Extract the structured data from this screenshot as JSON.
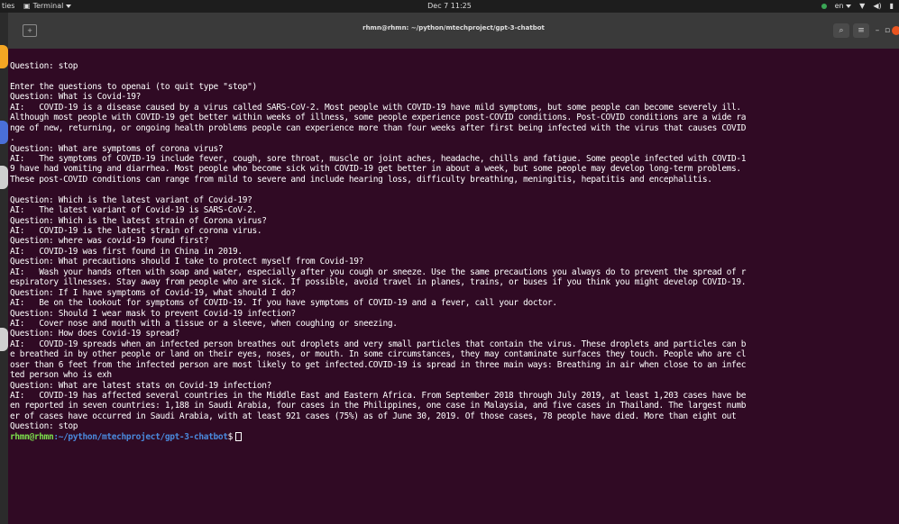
{
  "topbar": {
    "activities": "ties",
    "app_menu": "Terminal",
    "clock": "Dec 7  11:25",
    "keyboard": "en"
  },
  "window": {
    "title": "rhmn@rhmn: ~/python/mtechproject/gpt-3-chatbot"
  },
  "terminal": {
    "lines": [
      "Question: stop",
      "",
      "Enter the questions to openai (to quit type \"stop\")",
      "Question: What is Covid-19?",
      "AI:   COVID-19 is a disease caused by a virus called SARS-CoV-2. Most people with COVID-19 have mild symptoms, but some people can become severely ill.",
      "Although most people with COVID-19 get better within weeks of illness, some people experience post-COVID conditions. Post-COVID conditions are a wide ra",
      "nge of new, returning, or ongoing health problems people can experience more than four weeks after first being infected with the virus that causes COVID",
      ".",
      "Question: What are symptoms of corona virus?",
      "AI:   The symptoms of COVID-19 include fever, cough, sore throat, muscle or joint aches, headache, chills and fatigue. Some people infected with COVID-1",
      "9 have had vomiting and diarrhea. Most people who become sick with COVID-19 get better in about a week, but some people may develop long-term problems.",
      "These post-COVID conditions can range from mild to severe and include hearing loss, difficulty breathing, meningitis, hepatitis and encephalitis.",
      "",
      "Question: Which is the latest variant of Covid-19?",
      "AI:   The latest variant of Covid-19 is SARS-CoV-2.",
      "Question: Which is the latest strain of Corona virus?",
      "AI:   COVID-19 is the latest strain of corona virus.",
      "Question: where was covid-19 found first?",
      "AI:   COVID-19 was first found in China in 2019.",
      "Question: What precautions should I take to protect myself from Covid-19?",
      "AI:   Wash your hands often with soap and water, especially after you cough or sneeze. Use the same precautions you always do to prevent the spread of r",
      "espiratory illnesses. Stay away from people who are sick. If possible, avoid travel in planes, trains, or buses if you think you might develop COVID-19.",
      "Question: If I have symptoms of Covid-19, what should I do?",
      "AI:   Be on the lookout for symptoms of COVID-19. If you have symptoms of COVID-19 and a fever, call your doctor.",
      "Question: Should I wear mask to prevent Covid-19 infection?",
      "AI:   Cover nose and mouth with a tissue or a sleeve, when coughing or sneezing.",
      "Question: How does Covid-19 spread?",
      "AI:   COVID-19 spreads when an infected person breathes out droplets and very small particles that contain the virus. These droplets and particles can b",
      "e breathed in by other people or land on their eyes, noses, or mouth. In some circumstances, they may contaminate surfaces they touch. People who are cl",
      "oser than 6 feet from the infected person are most likely to get infected.COVID-19 is spread in three main ways: Breathing in air when close to an infec",
      "ted person who is exh",
      "Question: What are latest stats on Covid-19 infection?",
      "AI:   COVID-19 has affected several countries in the Middle East and Eastern Africa. From September 2018 through July 2019, at least 1,203 cases have be",
      "en reported in seven countries: 1,188 in Saudi Arabia, four cases in the Philippines, one case in Malaysia, and five cases in Thailand. The largest numb",
      "er of cases have occurred in Saudi Arabia, with at least 921 cases (75%) as of June 30, 2019. Of those cases, 78 people have died. More than eight out",
      "Question: stop"
    ],
    "prompt_user": "rhmn@rhmn",
    "prompt_path": ":~/python/mtechproject/gpt-3-chatbot",
    "prompt_symbol": "$"
  },
  "colors": {
    "terminal_bg": "#300a24",
    "prompt_user": "#7ce04c",
    "prompt_path": "#4a89dc",
    "close_button": "#e95420"
  }
}
